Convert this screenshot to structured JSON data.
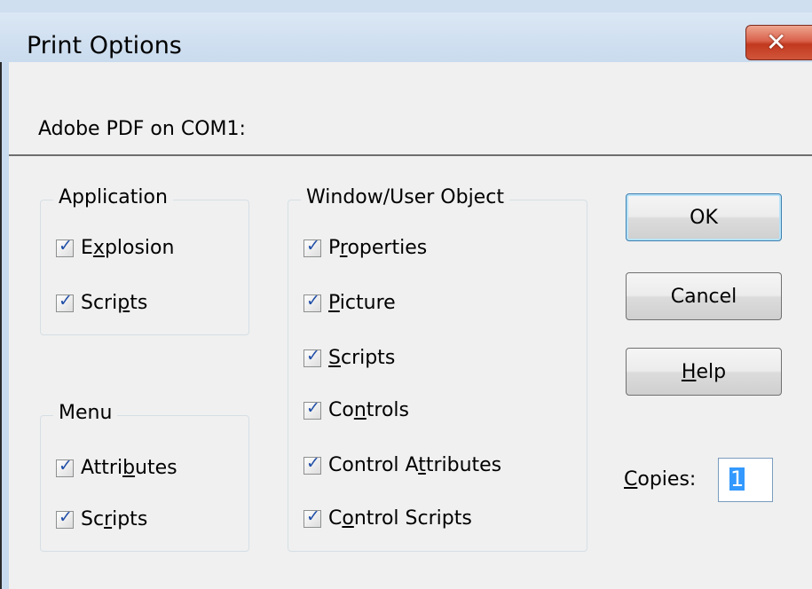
{
  "dialog": {
    "title": "Print Options",
    "close_label": "✕",
    "printer": "Adobe PDF on COM1:"
  },
  "application_group": {
    "label": "Application",
    "items": [
      {
        "pre": "E",
        "mn": "x",
        "post": "plosion",
        "checked": true
      },
      {
        "pre": "Scri",
        "mn": "p",
        "post": "ts",
        "checked": true
      }
    ]
  },
  "menu_group": {
    "label": "Menu",
    "items": [
      {
        "pre": "Attri",
        "mn": "b",
        "post": "utes",
        "checked": true
      },
      {
        "pre": "Sc",
        "mn": "r",
        "post": "ipts",
        "checked": true
      }
    ]
  },
  "window_group": {
    "label": "Window/User Object",
    "items": [
      {
        "pre": "P",
        "mn": "r",
        "post": "operties",
        "checked": true
      },
      {
        "pre": "",
        "mn": "P",
        "post": "icture",
        "checked": true
      },
      {
        "pre": "",
        "mn": "S",
        "post": "cripts",
        "checked": true
      },
      {
        "pre": "Co",
        "mn": "n",
        "post": "trols",
        "checked": true
      },
      {
        "pre": "Control A",
        "mn": "t",
        "post": "tributes",
        "checked": true
      },
      {
        "pre": "C",
        "mn": "o",
        "post": "ntrol Scripts",
        "checked": true
      }
    ]
  },
  "buttons": {
    "ok": "OK",
    "cancel": "Cancel",
    "help_mn": "H",
    "help_rest": "elp"
  },
  "copies": {
    "label_mn": "C",
    "label_rest": "opies:",
    "value": "1"
  }
}
